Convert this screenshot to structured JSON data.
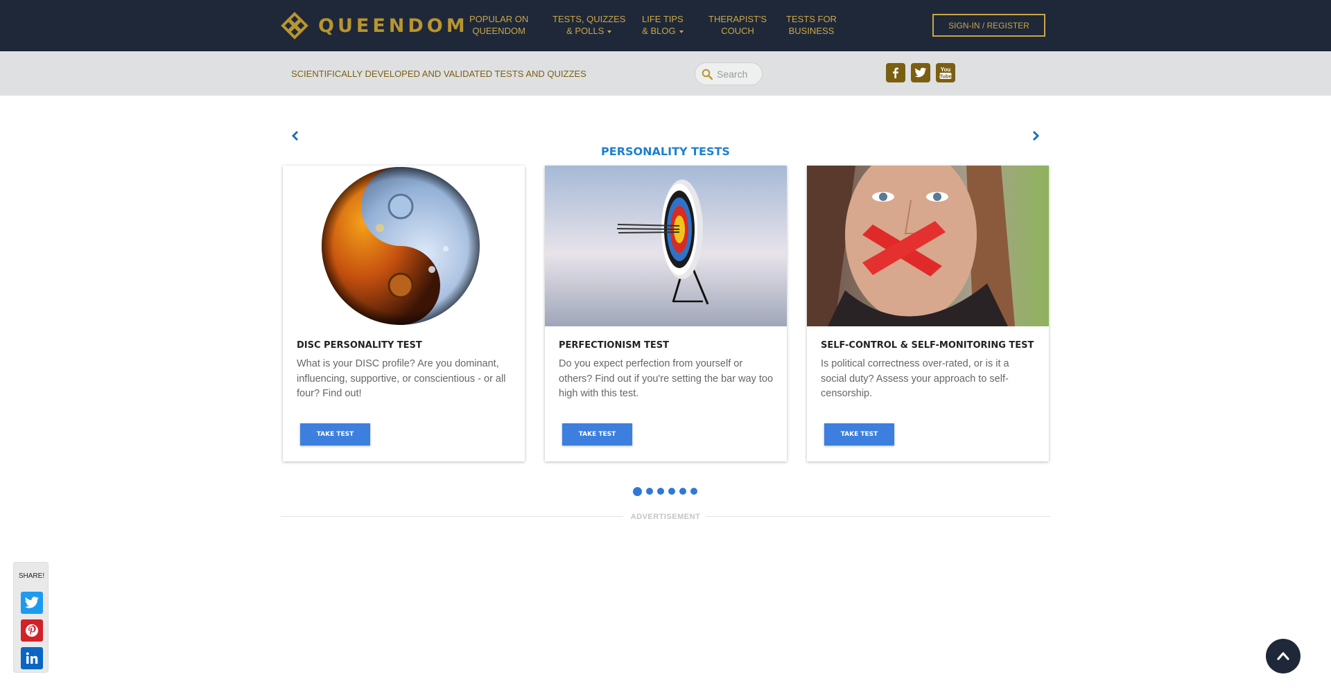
{
  "header": {
    "logo_text": "QUEENDOM",
    "nav": [
      {
        "line1": "POPULAR ON",
        "line2": "QUEENDOM",
        "has_dropdown": false
      },
      {
        "line1": "TESTS, QUIZZES",
        "line2": "& POLLS",
        "has_dropdown": true
      },
      {
        "line1": "LIFE TIPS",
        "line2": "& BLOG",
        "has_dropdown": true
      },
      {
        "line1": "THERAPIST'S",
        "line2": "COUCH",
        "has_dropdown": false
      },
      {
        "line1": "TESTS FOR",
        "line2": "BUSINESS",
        "has_dropdown": false
      }
    ],
    "signin_label": "SIGN-IN / REGISTER"
  },
  "subbar": {
    "tagline": "SCIENTIFICALLY DEVELOPED AND VALIDATED TESTS AND QUIZZES",
    "search_placeholder": "Search",
    "social_icons": [
      "facebook-icon",
      "twitter-icon",
      "youtube-icon"
    ]
  },
  "carousel": {
    "title": "PERSONALITY TESTS",
    "cards": [
      {
        "title": "DISC PERSONALITY TEST",
        "description": "What is your DISC profile? Are you dominant, influencing, supportive, or conscientious - or all four? Find out!",
        "button": "TAKE TEST",
        "image": "yin-yang-image"
      },
      {
        "title": "PERFECTIONISM TEST",
        "description": "Do you expect perfection from yourself or others? Find out if you're setting the bar way too high with this test.",
        "button": "TAKE TEST",
        "image": "archery-target-image"
      },
      {
        "title": "SELF-CONTROL & SELF-MONITORING TEST",
        "description": "Is political correctness over-rated, or is it a social duty? Assess your approach to self-censorship.",
        "button": "TAKE TEST",
        "image": "taped-mouth-woman-image"
      }
    ],
    "page_count": 6,
    "active_page": 1
  },
  "advertisement_label": "ADVERTISEMENT",
  "share": {
    "label": "SHARE!",
    "buttons": [
      "twitter-icon",
      "pinterest-icon",
      "linkedin-icon"
    ]
  },
  "colors": {
    "nav_bg": "#1f2838",
    "gold": "#c9a74a",
    "accent_blue": "#1d7fce",
    "button_blue": "#3c7fdf"
  }
}
